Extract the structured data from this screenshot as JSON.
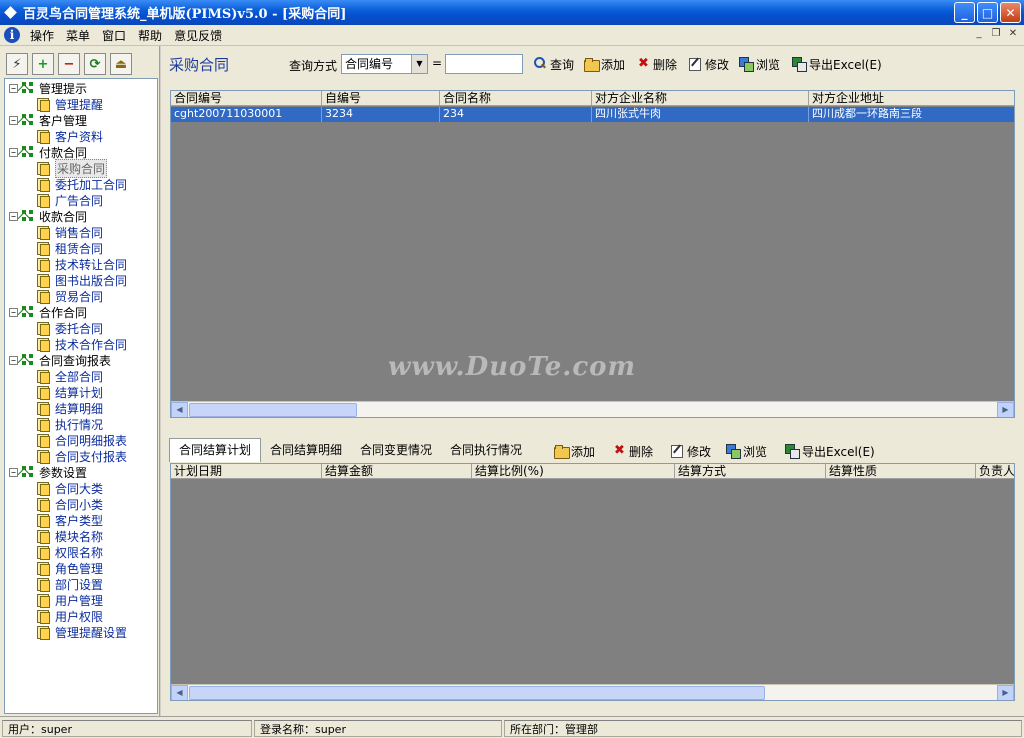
{
  "window": {
    "title": "百灵鸟合同管理系统_单机版(PIMS)v5.0 - [采购合同]",
    "controls": {
      "minimize": "_",
      "maximize": "□",
      "close": "✕"
    }
  },
  "menubar": {
    "items": [
      "操作",
      "菜单",
      "窗口",
      "帮助",
      "意见反馈"
    ],
    "mdi": {
      "minimize": "_",
      "restore": "❐",
      "close": "✕"
    }
  },
  "left_toolbar": {
    "buttons": [
      "⚡",
      "+",
      "−",
      "⟳",
      "⏏"
    ]
  },
  "tree": [
    {
      "label": "管理提示",
      "children": [
        "管理提醒"
      ]
    },
    {
      "label": "客户管理",
      "children": [
        "客户资料"
      ]
    },
    {
      "label": "付款合同",
      "children": [
        "采购合同",
        "委托加工合同",
        "广告合同"
      ],
      "selected": "采购合同"
    },
    {
      "label": "收款合同",
      "children": [
        "销售合同",
        "租赁合同",
        "技术转让合同",
        "图书出版合同",
        "贸易合同"
      ]
    },
    {
      "label": "合作合同",
      "children": [
        "委托合同",
        "技术合作合同"
      ]
    },
    {
      "label": "合同查询报表",
      "children": [
        "全部合同",
        "结算计划",
        "结算明细",
        "执行情况",
        "合同明细报表",
        "合同支付报表"
      ]
    },
    {
      "label": "参数设置",
      "children": [
        "合同大类",
        "合同小类",
        "客户类型",
        "模块名称",
        "权限名称",
        "角色管理",
        "部门设置",
        "用户管理",
        "用户权限",
        "管理提醒设置"
      ]
    }
  ],
  "header": {
    "page_title": "采购合同",
    "query_label": "查询方式",
    "query_select": "合同编号",
    "query_eq": "=",
    "query_value": "",
    "buttons": {
      "search": "查询",
      "add": "添加",
      "delete": "删除",
      "edit": "修改",
      "browse": "浏览",
      "export": "导出Excel(E)"
    }
  },
  "main_grid": {
    "columns": [
      "合同编号",
      "自编号",
      "合同名称",
      "对方企业名称",
      "对方企业地址"
    ],
    "rows": [
      [
        "cght200711030001",
        "3234",
        "234",
        "四川张式牛肉",
        "四川成都一环路南三段"
      ]
    ]
  },
  "watermark": "www.DuoTe.com",
  "detail": {
    "tabs": [
      "合同结算计划",
      "合同结算明细",
      "合同变更情况",
      "合同执行情况"
    ],
    "active_tab": "合同结算计划",
    "buttons": {
      "add": "添加",
      "delete": "删除",
      "edit": "修改",
      "browse": "浏览",
      "export": "导出Excel(E)"
    },
    "columns": [
      "计划日期",
      "结算金额",
      "结算比例(%)",
      "结算方式",
      "结算性质",
      "负责人"
    ]
  },
  "statusbar": {
    "user": "用户：super",
    "login": "登录名称：super",
    "dept": "所在部门：管理部"
  }
}
